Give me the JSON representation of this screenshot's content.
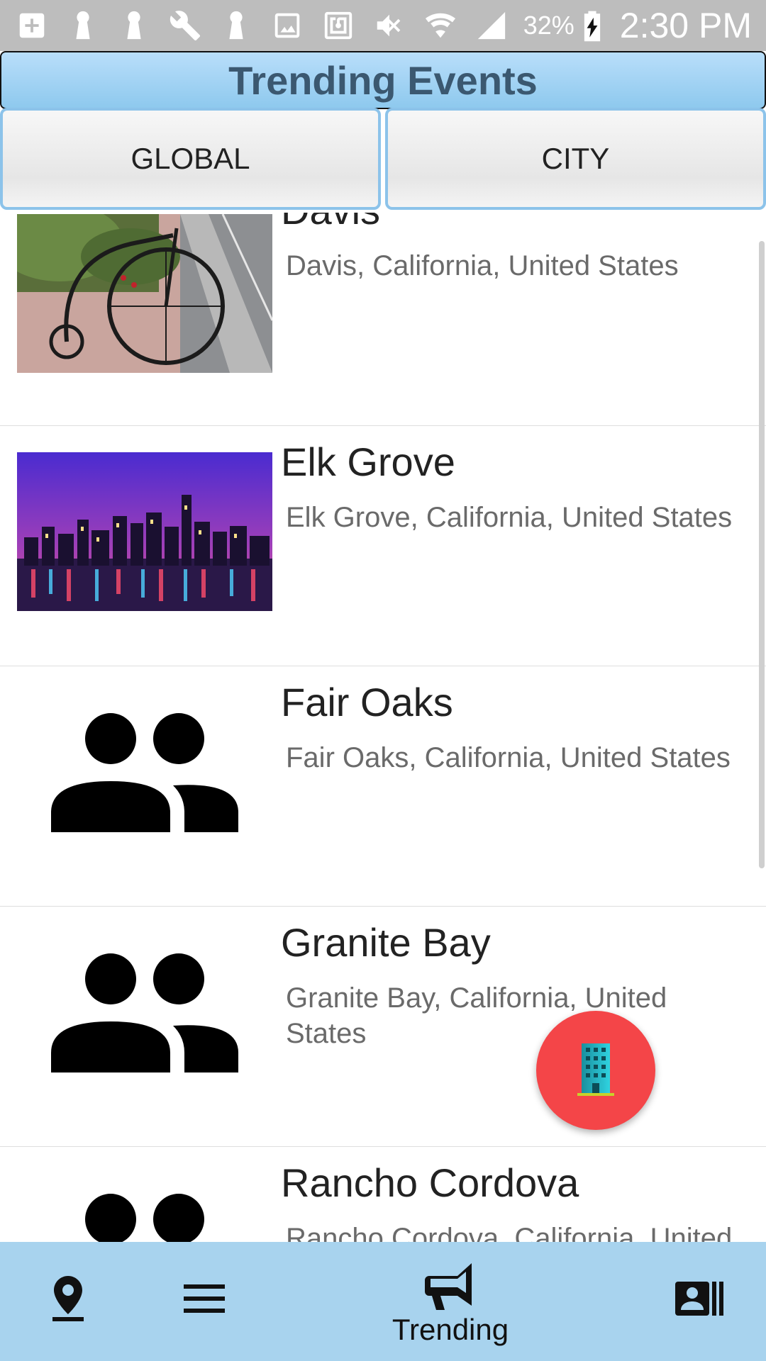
{
  "status_bar": {
    "battery_percent": "32%",
    "time": "2:30 PM",
    "icons": [
      "add-box-icon",
      "keyhole-icon",
      "keyhole-icon",
      "wrench-icon",
      "keyhole-icon",
      "image-icon",
      "nfc-icon",
      "mute-icon",
      "wifi-icon",
      "signal-icon",
      "battery-charging-icon"
    ]
  },
  "header": {
    "title": "Trending Events"
  },
  "tabs": [
    {
      "label": "GLOBAL"
    },
    {
      "label": "CITY"
    }
  ],
  "events": [
    {
      "name": "Davis",
      "location": "Davis, California, United States",
      "thumbnail": "penny-farthing-bicycle-photo"
    },
    {
      "name": "Elk Grove",
      "location": "Elk Grove, California, United States",
      "thumbnail": "city-skyline-night-photo"
    },
    {
      "name": "Fair Oaks",
      "location": "Fair Oaks, California, United States",
      "thumbnail": "people-group-icon"
    },
    {
      "name": "Granite Bay",
      "location": "Granite Bay, California, United States",
      "thumbnail": "people-group-icon"
    },
    {
      "name": "Rancho Cordova",
      "location": "Rancho Cordova, California, United States",
      "thumbnail": "people-group-icon"
    }
  ],
  "fab": {
    "icon": "building-icon",
    "color": "#f44548"
  },
  "bottom_nav": {
    "items": [
      {
        "icon": "location-pin-icon",
        "label": ""
      },
      {
        "icon": "menu-icon",
        "label": ""
      },
      {
        "icon": "megaphone-icon",
        "label": "Trending"
      },
      {
        "icon": "contact-list-icon",
        "label": ""
      }
    ],
    "background": "#a8d3ee"
  },
  "colors": {
    "header_gradient_top": "#b9defa",
    "header_gradient_bottom": "#8ec9ee",
    "title_text": "#3b5870",
    "tab_border": "#8cc3ea"
  }
}
